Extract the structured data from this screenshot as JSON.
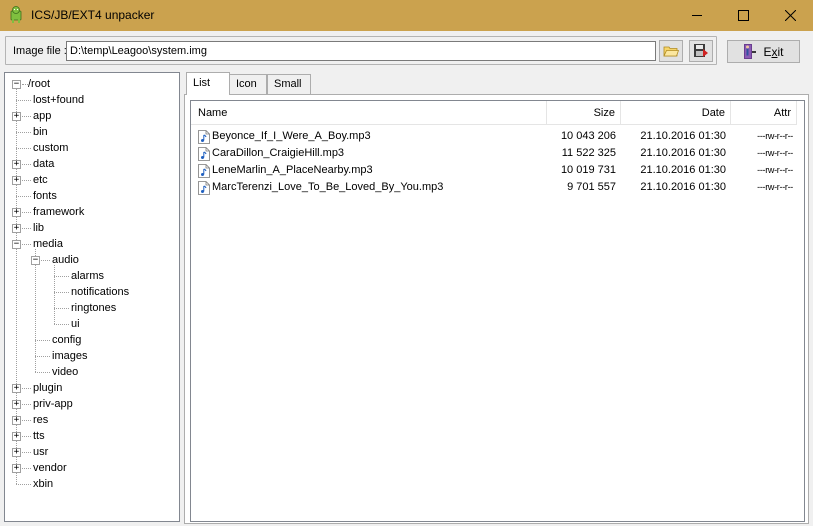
{
  "window": {
    "title": "ICS/JB/EXT4 unpacker",
    "title_bar_color": "#cba24e",
    "controls": {
      "minimize_icon": "minimize-icon",
      "maximize_icon": "maximize-icon",
      "close_icon": "close-icon"
    }
  },
  "toolbar": {
    "image_label": "Image file :",
    "image_path": "D:\\temp\\Leagoo\\system.img",
    "open_icon": "folder-open-icon",
    "extract_icon": "save-extract-icon",
    "exit_label_prefix": "E",
    "exit_label_underlined": "x",
    "exit_label_suffix": "it"
  },
  "tree": {
    "root": "/root",
    "items": [
      {
        "label": "lost+found",
        "expandable": false,
        "expanded": false
      },
      {
        "label": "app",
        "expandable": true,
        "expanded": false
      },
      {
        "label": "bin",
        "expandable": false,
        "expanded": false
      },
      {
        "label": "custom",
        "expandable": false,
        "expanded": false
      },
      {
        "label": "data",
        "expandable": true,
        "expanded": false
      },
      {
        "label": "etc",
        "expandable": true,
        "expanded": false
      },
      {
        "label": "fonts",
        "expandable": false,
        "expanded": false
      },
      {
        "label": "framework",
        "expandable": true,
        "expanded": false
      },
      {
        "label": "lib",
        "expandable": true,
        "expanded": false
      },
      {
        "label": "media",
        "expandable": true,
        "expanded": true
      },
      {
        "label": "audio",
        "expandable": true,
        "expanded": true
      },
      {
        "label": "alarms",
        "expandable": false,
        "expanded": false
      },
      {
        "label": "notifications",
        "expandable": false,
        "expanded": false
      },
      {
        "label": "ringtones",
        "expandable": false,
        "expanded": false
      },
      {
        "label": "ui",
        "expandable": false,
        "expanded": false
      },
      {
        "label": "config",
        "expandable": false,
        "expanded": false
      },
      {
        "label": "images",
        "expandable": false,
        "expanded": false
      },
      {
        "label": "video",
        "expandable": false,
        "expanded": false
      },
      {
        "label": "plugin",
        "expandable": true,
        "expanded": false
      },
      {
        "label": "priv-app",
        "expandable": true,
        "expanded": false
      },
      {
        "label": "res",
        "expandable": true,
        "expanded": false
      },
      {
        "label": "tts",
        "expandable": true,
        "expanded": false
      },
      {
        "label": "usr",
        "expandable": true,
        "expanded": false
      },
      {
        "label": "vendor",
        "expandable": true,
        "expanded": false
      },
      {
        "label": "xbin",
        "expandable": false,
        "expanded": false
      }
    ]
  },
  "tabs": [
    {
      "label": "List",
      "active": true
    },
    {
      "label": "Icon",
      "active": false
    },
    {
      "label": "Small",
      "active": false
    }
  ],
  "list": {
    "columns": {
      "name": "Name",
      "size": "Size",
      "date": "Date",
      "attr": "Attr"
    },
    "rows": [
      {
        "name": "Beyonce_If_I_Were_A_Boy.mp3",
        "size": "10 043 206",
        "date": "21.10.2016 01:30",
        "attr": "---rw-r--r--"
      },
      {
        "name": "CaraDillon_CraigieHill.mp3",
        "size": "11 522 325",
        "date": "21.10.2016 01:30",
        "attr": "---rw-r--r--"
      },
      {
        "name": "LeneMarlin_A_PlaceNearby.mp3",
        "size": "10 019 731",
        "date": "21.10.2016 01:30",
        "attr": "---rw-r--r--"
      },
      {
        "name": "MarcTerenzi_Love_To_Be_Loved_By_You.mp3",
        "size": "9 701 557",
        "date": "21.10.2016 01:30",
        "attr": "---rw-r--r--"
      }
    ]
  }
}
